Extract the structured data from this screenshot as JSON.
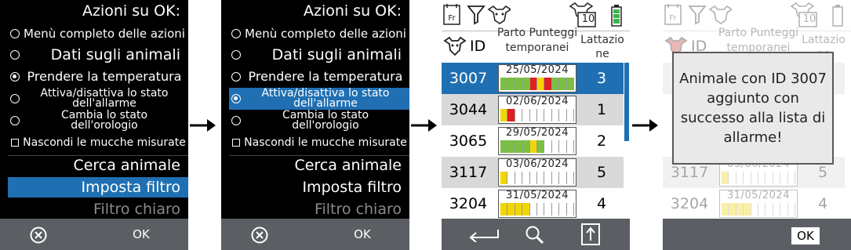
{
  "menu": {
    "title": "Azioni su OK:",
    "items": [
      {
        "label": "Menù completo delle azioni",
        "icon": "radio-empty"
      },
      {
        "label": "Dati sugli animali",
        "icon": "radio-empty"
      },
      {
        "label": "Prendere la temperatura",
        "icon": "radio-filled"
      },
      {
        "label": "Attiva/disattiva lo stato dell'allarme",
        "icon": "radio-empty"
      },
      {
        "label": "Cambia lo stato dell'orologio",
        "icon": "radio-empty"
      },
      {
        "label": "Nascondi le mucche misurate",
        "icon": "checkbox-empty"
      }
    ],
    "actions": [
      "Cerca animale",
      "Imposta filtro",
      "Filtro chiaro"
    ],
    "footer_ok": "OK"
  },
  "list": {
    "header": {
      "id": "ID",
      "scores": "Parto Punteggi temporanei",
      "lactation": "Lattazio ne"
    },
    "badge_count": "10",
    "rows": [
      {
        "id": "3007",
        "date": "25/05/2024",
        "lactation": "3"
      },
      {
        "id": "3044",
        "date": "02/06/2024",
        "lactation": "1"
      },
      {
        "id": "3065",
        "date": "29/05/2024",
        "lactation": "2"
      },
      {
        "id": "3117",
        "date": "03/06/2024",
        "lactation": "5"
      },
      {
        "id": "3204",
        "date": "31/05/2024",
        "lactation": "4"
      }
    ]
  },
  "popup": {
    "message": "Animale con ID 3007 aggiunto con successo alla lista di allarme!",
    "ok": "OK"
  },
  "colors": {
    "accent": "#1f6fb2",
    "green": "#7bc043",
    "yellow": "#f2d600",
    "red": "#e02020",
    "footer": "#5b5e63"
  }
}
